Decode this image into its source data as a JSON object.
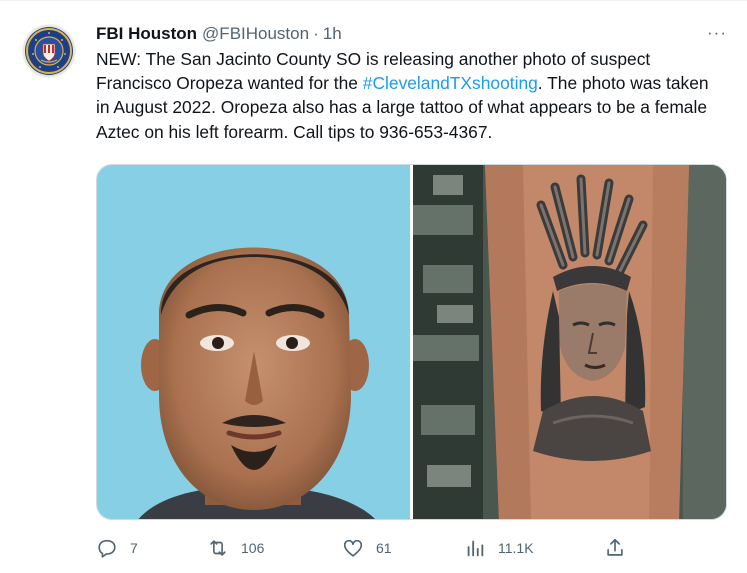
{
  "tweet": {
    "display_name": "FBI Houston",
    "handle": "@FBIHouston",
    "separator": "·",
    "time": "1h",
    "more": "···",
    "text_before": "NEW: The San Jacinto County SO is releasing another photo of suspect Francisco Oropeza wanted for the ",
    "hashtag": "#ClevelandTXshooting",
    "text_after": ". The photo was taken in August 2022. Oropeza also has a large tattoo of what appears to be a female Aztec on his left forearm. Call tips to 936-653-4367."
  },
  "media": {
    "photos": [
      {
        "name": "suspect-portrait",
        "icon": "suspect-photo"
      },
      {
        "name": "forearm-tattoo",
        "icon": "tattoo-photo"
      }
    ]
  },
  "actions": {
    "reply": {
      "count": "7",
      "icon": "reply-icon"
    },
    "retweet": {
      "count": "106",
      "icon": "retweet-icon"
    },
    "like": {
      "count": "61",
      "icon": "like-icon"
    },
    "views": {
      "count": "11.1K",
      "icon": "views-icon"
    },
    "share": {
      "icon": "share-icon"
    }
  },
  "colors": {
    "link": "#1d9bf0",
    "muted": "#536471",
    "text": "#0f1419",
    "border": "#cfd9de"
  }
}
